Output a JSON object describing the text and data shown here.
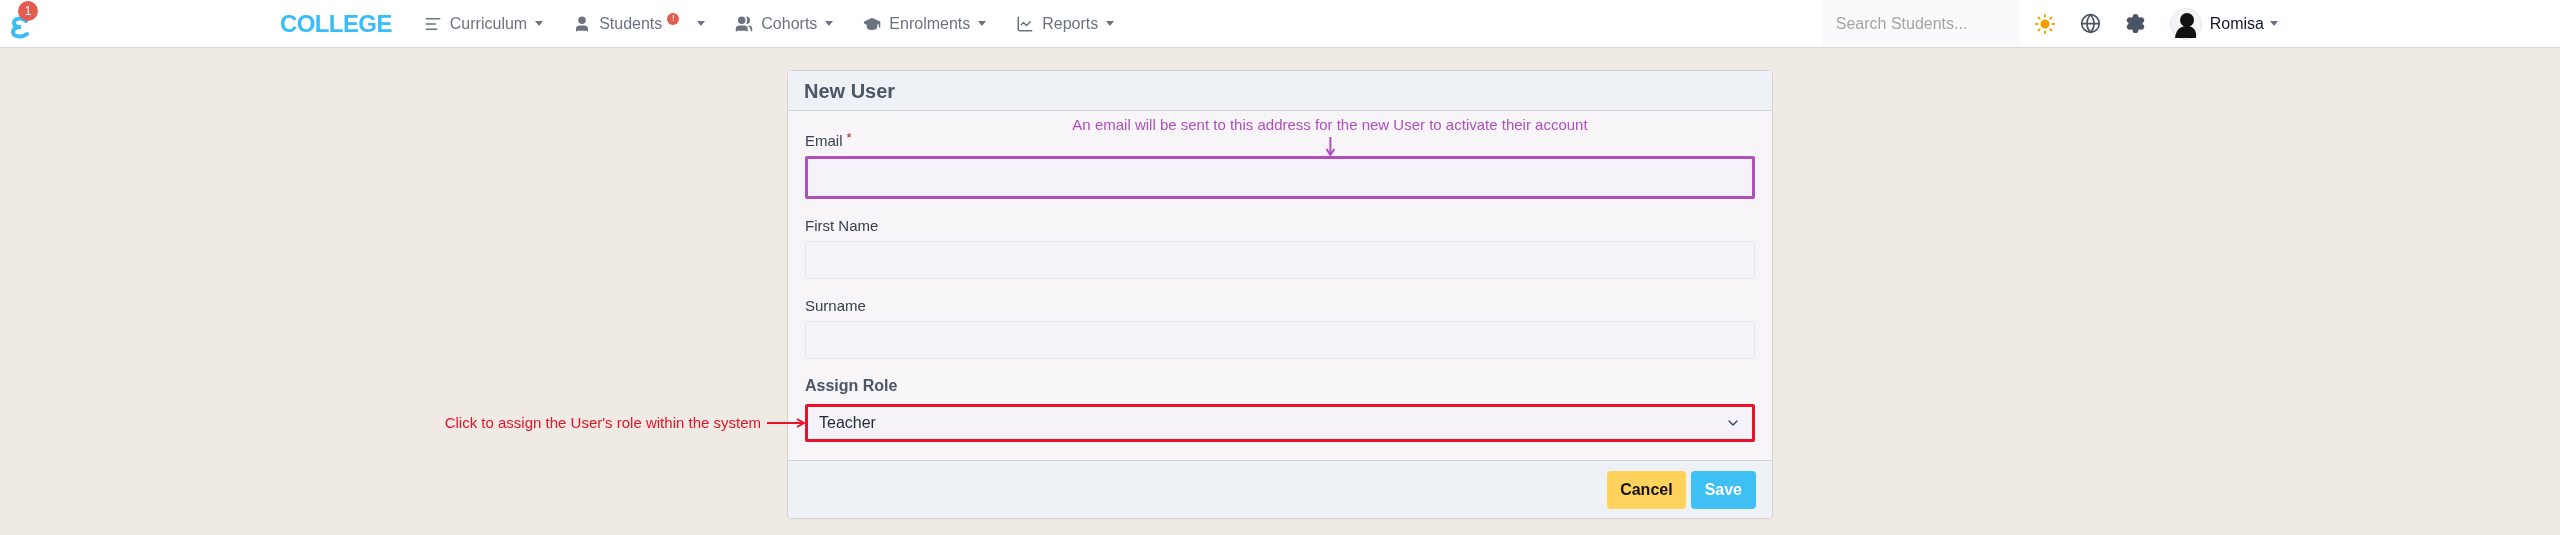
{
  "navbar": {
    "logo_badge": "1",
    "brand": "COLLEGE",
    "menu": [
      {
        "label": "Curriculum"
      },
      {
        "label": "Students",
        "badge": "!"
      },
      {
        "label": "Cohorts"
      },
      {
        "label": "Enrolments"
      },
      {
        "label": "Reports"
      }
    ],
    "search": {
      "placeholder": "Search Students..."
    },
    "user": {
      "name": "Romisa"
    }
  },
  "form": {
    "title": "New User",
    "required_mark": "*",
    "fields": [
      {
        "label": "Email",
        "required": true,
        "annotation": {
          "text": "An email will be sent to this address for the new User to activate their account",
          "color": "#b04fbd"
        }
      },
      {
        "label": "First Name",
        "required": false
      },
      {
        "label": "Surname",
        "required": false
      }
    ],
    "role": {
      "label": "Assign Role",
      "value": "Teacher",
      "annotation": {
        "text": "Click to assign the User's role within the system",
        "color": "#ea1228"
      }
    },
    "buttons": [
      {
        "label": "Cancel",
        "kind": "secondary"
      },
      {
        "label": "Save",
        "kind": "primary"
      }
    ]
  }
}
